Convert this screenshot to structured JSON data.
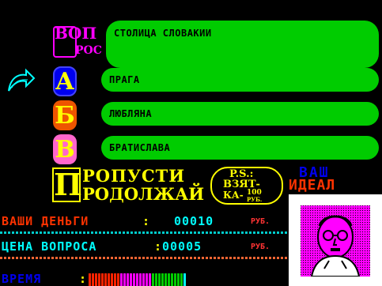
{
  "question": {
    "text": "СТОЛИЦА СЛОВАКИИ"
  },
  "answers": [
    {
      "letter": "А",
      "text": "ПРАГА",
      "badge_color": "#0000ee"
    },
    {
      "letter": "Б",
      "text": "ЛЮБЛЯНА",
      "badge_color": "#ee5500"
    },
    {
      "letter": "В",
      "text": "БРАТИСЛАВА",
      "badge_color": "#ff66cc"
    }
  ],
  "logo": {
    "line1": "ВОП",
    "line2": "РОС"
  },
  "skip": {
    "big_letter": "П",
    "line1": "РОПУСТИ",
    "line2": "РОДОЛЖАЙ"
  },
  "ps": {
    "line1": "P.S.:",
    "line2": "ВЗЯТ-",
    "line3": "КА-",
    "amount": "100",
    "unit": "РУБ."
  },
  "ideal": {
    "line1": "ВАШ",
    "line2": "ИДЕАЛ"
  },
  "money": {
    "label": "ВАШИ ДЕНЬГИ",
    "sep": ":",
    "value": "00010",
    "unit": "РУБ."
  },
  "price": {
    "label": "ЦЕНА ВОПРОСА",
    "sep": ":",
    "value": "00005",
    "unit": "РУБ."
  },
  "time": {
    "label": "ВРЕМЯ",
    "sep": ":",
    "remaining_fraction": 0.6
  },
  "colors": {
    "panel_green": "#00cc00",
    "hud_red": "#ff3300",
    "hud_cyan": "#00ffff",
    "accent_yellow": "#ffff00",
    "accent_magenta": "#ff00ff"
  },
  "icons": {
    "back": "back-arrow-icon",
    "portrait": "portrait-icon"
  }
}
